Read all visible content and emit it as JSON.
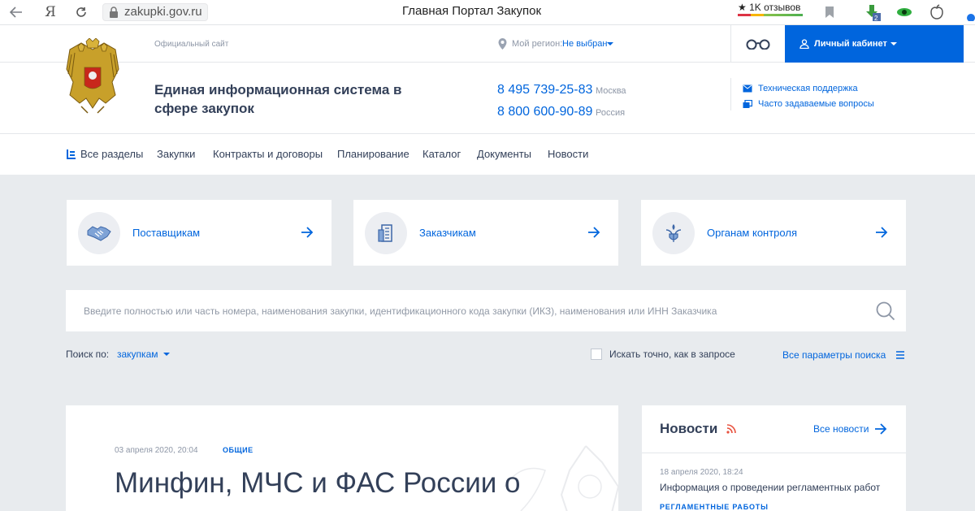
{
  "browser": {
    "url": "zakupki.gov.ru",
    "tab_title": "Главная Портал Закупок",
    "reviews": "★ 1K отзывов"
  },
  "header": {
    "official_site": "Официальный сайт",
    "region_label": "Мой регион:",
    "region_value": "Не выбран",
    "cabinet_label": "Личный кабинет",
    "system_title": "Единая информационная система в сфере закупок",
    "phones": [
      {
        "number": "8 495 739-25-83",
        "caption": "Москва"
      },
      {
        "number": "8 800 600-90-89",
        "caption": "Россия"
      }
    ],
    "support_links": [
      "Техническая поддержка",
      "Часто задаваемые вопросы"
    ]
  },
  "nav": {
    "items": [
      "Все разделы",
      "Закупки",
      "Контракты и договоры",
      "Планирование",
      "Каталог",
      "Документы",
      "Новости"
    ]
  },
  "cards": [
    {
      "label": "Поставщикам",
      "icon": "handshake-icon"
    },
    {
      "label": "Заказчикам",
      "icon": "building-icon"
    },
    {
      "label": "Органам контроля",
      "icon": "emblem-icon"
    }
  ],
  "search": {
    "placeholder": "Введите полностью или часть номера, наименования закупки, идентификационного кода закупки (ИКЗ), наименования или ИНН Заказчика",
    "search_by_label": "Поиск по:",
    "search_by_value": "закупкам",
    "exact_label": "Искать точно, как в запросе",
    "exact_checked": false,
    "all_params": "Все параметры поиска"
  },
  "main_news": {
    "date": "03 апреля 2020, 20:04",
    "tag": "ОБЩИЕ",
    "title": "Минфин, МЧС и ФАС России о"
  },
  "side_news": {
    "title": "Новости",
    "all_link": "Все новости",
    "item": {
      "date": "18 апреля 2020, 18:24",
      "text": "Информация о проведении регламентных работ",
      "tag": "РЕГЛАМЕНТНЫЕ РАБОТЫ"
    }
  },
  "colors": {
    "accent": "#0065dd",
    "text": "#334059",
    "muted": "#8d96a6",
    "background": "#e8ebee"
  }
}
